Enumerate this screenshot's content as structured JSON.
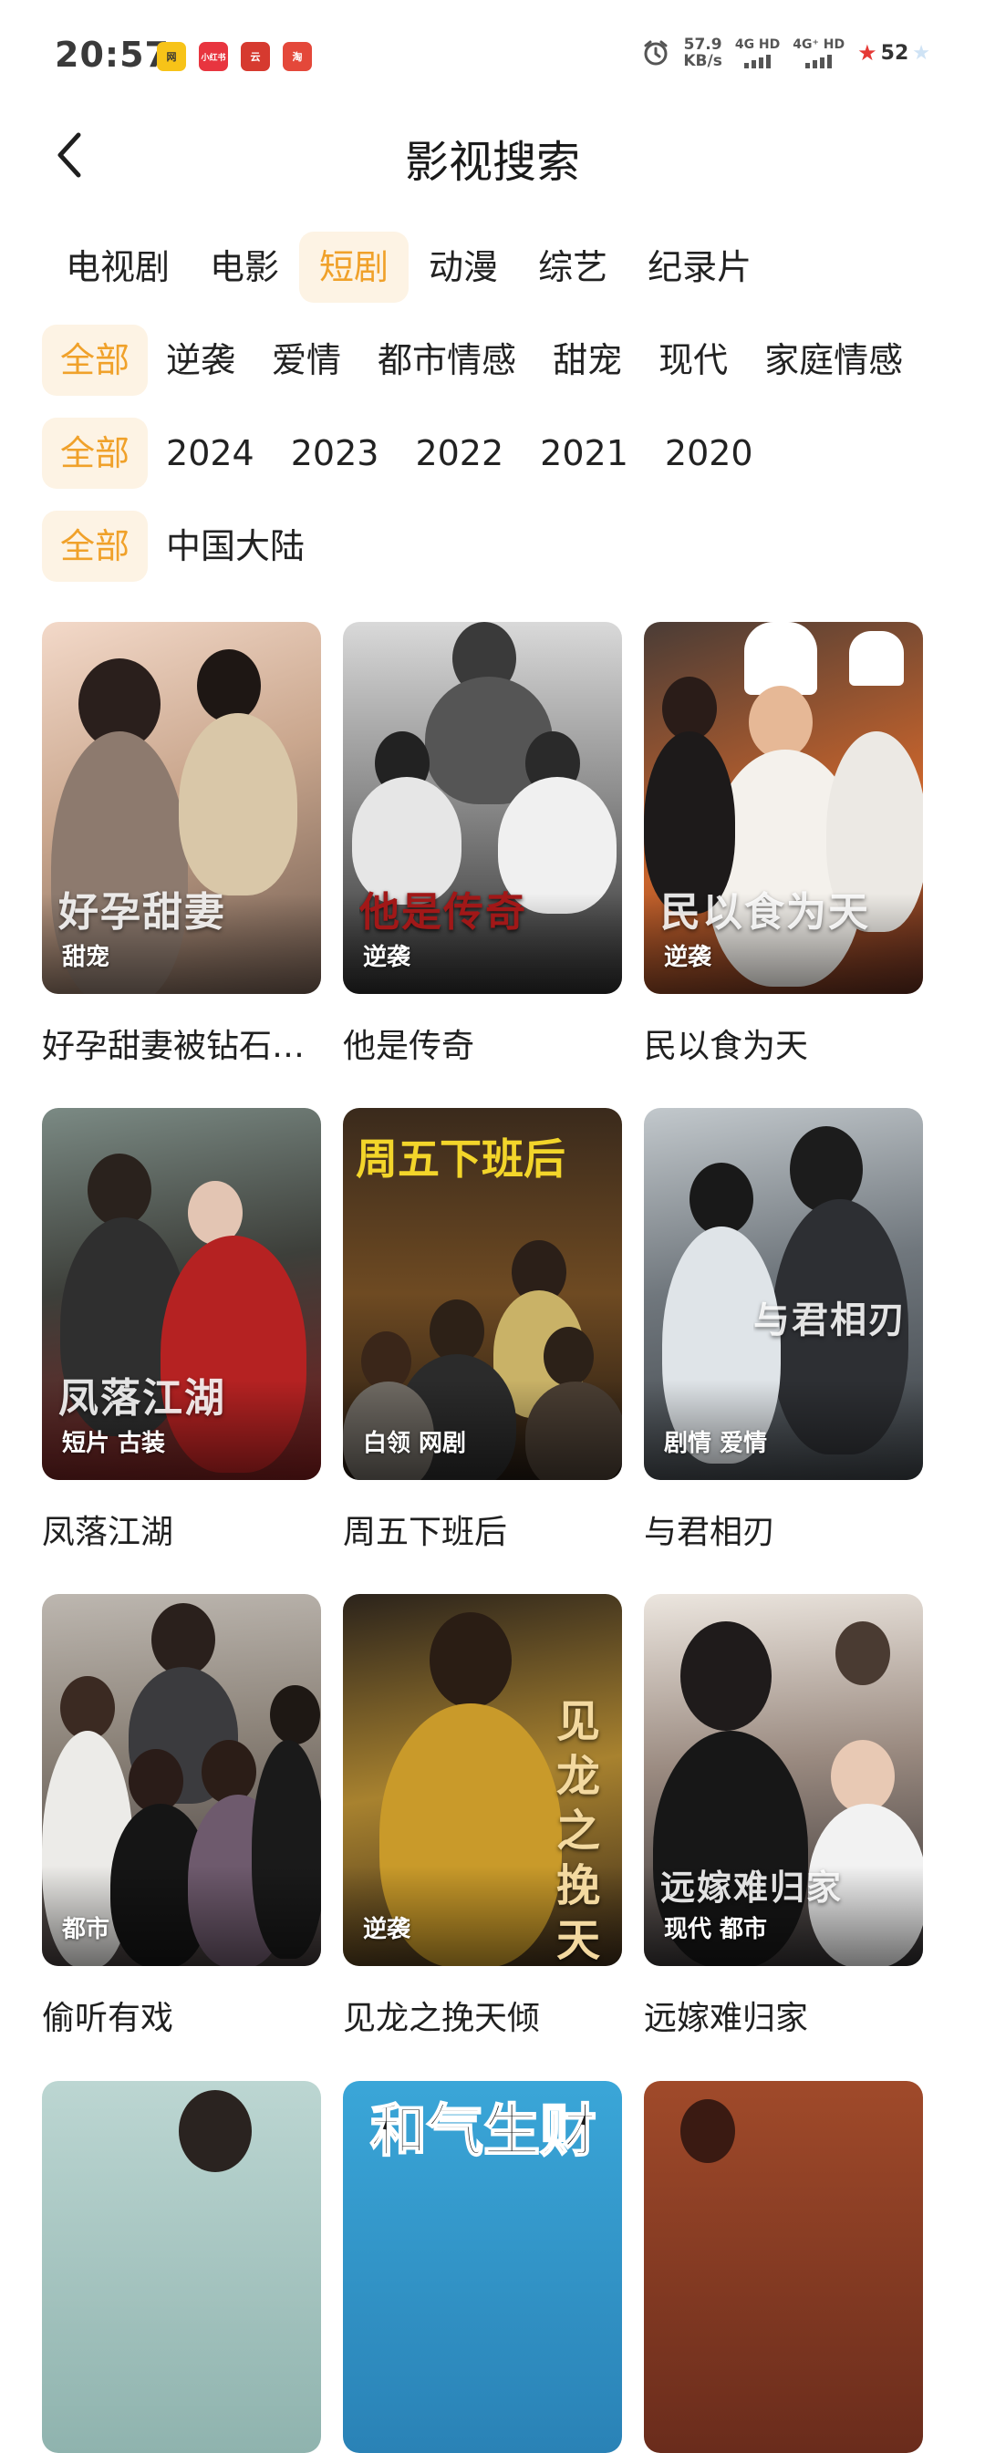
{
  "status_bar": {
    "time": "20:57",
    "net_speed_value": "57.9",
    "net_speed_unit": "KB/s",
    "sim1": "4G HD",
    "sim2": "4G⁺ HD",
    "battery": "52",
    "app_icons": [
      {
        "label": "网",
        "color": "#f7c318"
      },
      {
        "label": "小红书",
        "color": "#e8353f"
      },
      {
        "label": "云",
        "color": "#d63a2f"
      },
      {
        "label": "淘",
        "color": "#e4483a"
      }
    ]
  },
  "header": {
    "title": "影视搜索",
    "back_icon": "chevron-left-icon"
  },
  "filters": {
    "types": [
      "电视剧",
      "电影",
      "短剧",
      "动漫",
      "综艺",
      "纪录片"
    ],
    "types_selected": 2,
    "genres": [
      "全部",
      "逆袭",
      "爱情",
      "都市情感",
      "甜宠",
      "现代",
      "家庭情感"
    ],
    "genres_selected": 0,
    "years": [
      "全部",
      "2024",
      "2023",
      "2022",
      "2021",
      "2020"
    ],
    "years_selected": 0,
    "regions": [
      "全部",
      "中国大陆"
    ],
    "regions_selected": 0
  },
  "colors": {
    "accent": "#f0a12a",
    "accent_bg": "#fdf3e4"
  },
  "items": [
    {
      "title": "好孕甜妻被钻石老公宠上天",
      "tag": "甜宠",
      "poster_text": "好孕甜妻"
    },
    {
      "title": "他是传奇",
      "tag": "逆袭",
      "poster_text": "他是传奇"
    },
    {
      "title": "民以食为天",
      "tag": "逆袭",
      "poster_text": "民以食为天"
    },
    {
      "title": "凤落江湖",
      "tag": "短片 古装",
      "poster_text": "凤落江湖"
    },
    {
      "title": "周五下班后",
      "tag": "白领 网剧",
      "poster_text": "周五下班后"
    },
    {
      "title": "与君相刃",
      "tag": "剧情 爱情",
      "poster_text": "与君相刃"
    },
    {
      "title": "偷听有戏",
      "tag": "都市",
      "poster_text": ""
    },
    {
      "title": "见龙之挽天倾",
      "tag": "逆袭",
      "poster_text": "见龙之挽天倾"
    },
    {
      "title": "远嫁难归家",
      "tag": "现代 都市",
      "poster_text": "远嫁难归家"
    },
    {
      "title": "",
      "tag": "",
      "poster_text": ""
    },
    {
      "title": "",
      "tag": "",
      "poster_text": "和气生财"
    },
    {
      "title": "",
      "tag": "",
      "poster_text": ""
    }
  ]
}
